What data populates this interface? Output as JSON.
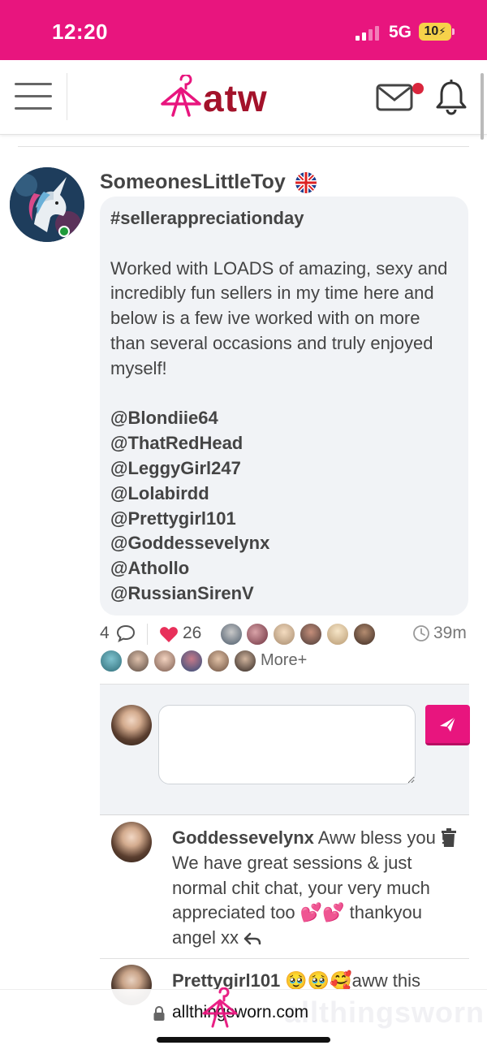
{
  "status_bar": {
    "time": "12:20",
    "network": "5G",
    "battery": "10"
  },
  "header": {
    "logo_text": "atw",
    "icons": [
      "menu-icon",
      "mail-icon",
      "bell-icon"
    ],
    "mail_unread": true
  },
  "post": {
    "author": "SomeonesLittleToy",
    "author_flag": "uk-flag",
    "online": true,
    "hashtag": "#sellerappreciationday",
    "body": "Worked with LOADS of amazing, sexy and incredibly fun sellers in my time here and below is a few ive worked with on more than several occasions and truly enjoyed myself!",
    "mentions": [
      "@Blondiie64",
      "@ThatRedHead",
      "@LeggyGirl247",
      "@Lolabirdd",
      "@Prettygirl101",
      "@Goddessevelynx",
      "@Athollo",
      "@RussianSirenV"
    ],
    "comment_count": "4",
    "like_count": "26",
    "time_ago": "39m",
    "more_label": "More+"
  },
  "composer": {
    "placeholder": ""
  },
  "comments": [
    {
      "author": "Goddessevelynx",
      "text": "Aww bless you ! We have great sessions & just normal chit chat, your very much appreciated too 💕💕 thankyou angel xx"
    },
    {
      "author": "Prettygirl101",
      "text": "🥹🥹🥰aww this"
    }
  ],
  "browser": {
    "url": "allthingsworn.com",
    "watermark": "allthingsworn"
  },
  "colors": {
    "brand_pink": "#e8157e",
    "logo_red": "#a3122a",
    "bubble_bg": "#f1f3f6",
    "heart": "#e8305a"
  }
}
